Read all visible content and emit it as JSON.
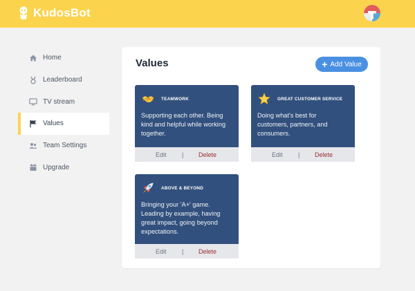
{
  "app": {
    "name": "KudosBot"
  },
  "sidebar": {
    "items": [
      {
        "label": "Home",
        "icon": "home-icon"
      },
      {
        "label": "Leaderboard",
        "icon": "medal-icon"
      },
      {
        "label": "TV stream",
        "icon": "tv-icon"
      },
      {
        "label": "Values",
        "icon": "flag-icon",
        "active": true
      },
      {
        "label": "Team Settings",
        "icon": "users-icon"
      },
      {
        "label": "Upgrade",
        "icon": "calendar-icon"
      }
    ]
  },
  "main": {
    "title": "Values",
    "add_button": {
      "icon": "+",
      "label": "Add Value"
    }
  },
  "values": [
    {
      "title": "TEAMWORK",
      "emoji": "handshake-emoji",
      "description": "Supporting each other. Being kind and helpful while working together.",
      "edit_label": "Edit",
      "separator": "|",
      "delete_label": "Delete"
    },
    {
      "title": "GREAT CUSTOMER SERVICE",
      "emoji": "star-emoji",
      "description": "Doing what's best for customers, partners, and consumers.",
      "edit_label": "Edit",
      "separator": "|",
      "delete_label": "Delete"
    },
    {
      "title": "ABOVE & BEYOND",
      "emoji": "rocket-emoji",
      "description": "Bringing your 'A+' game. Leading by example, having great impact, going beyond expectations.",
      "edit_label": "Edit",
      "separator": "|",
      "delete_label": "Delete"
    }
  ],
  "colors": {
    "topbar": "#fcd34d",
    "card": "#32507d",
    "accent": "#4a90e2",
    "delete": "#9b2c2c"
  }
}
